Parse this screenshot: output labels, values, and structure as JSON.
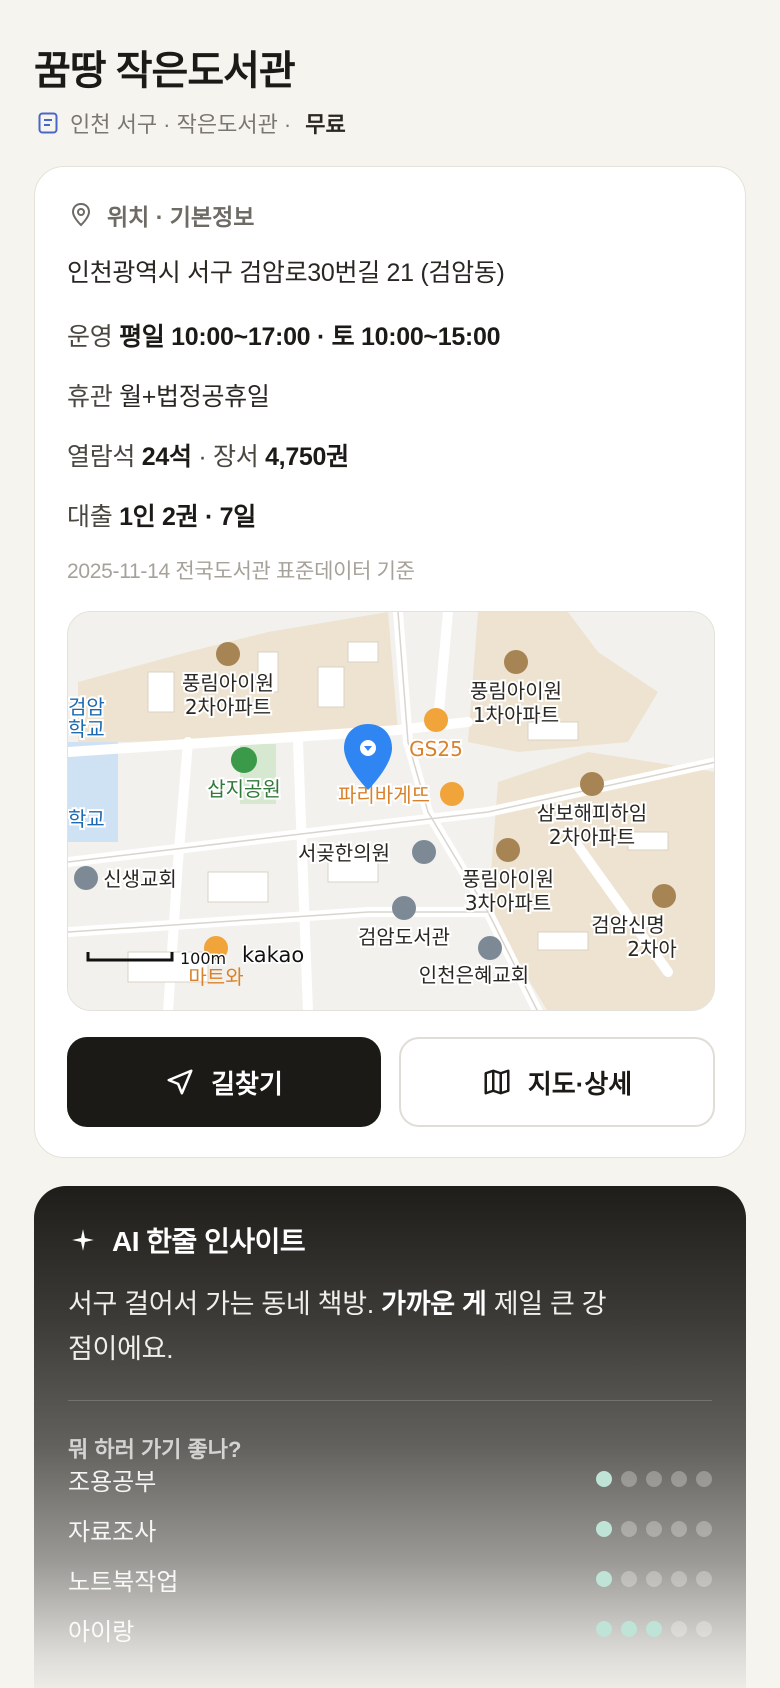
{
  "header": {
    "title": "꿈땅 작은도서관",
    "meta": "인천 서구 · 작은도서관 ·",
    "fee": "무료"
  },
  "info": {
    "section_title": "위치 · 기본정보",
    "address": "인천광역시 서구 검암로30번길 21 (검암동)",
    "hours_label": "운영",
    "hours_weekday": "평일 10:00~17:00",
    "hours_sep": "·",
    "hours_sat": "토 10:00~15:00",
    "closed_label": "휴관",
    "closed_value": "월+법정공휴일",
    "seats_label": "열람석",
    "seats_value": "24석",
    "books_label": "· 장서",
    "books_value": "4,750권",
    "loan_label": "대출",
    "loan_value": "1인 2권 · 7일",
    "data_date": "2025-11-14 전국도서관 표준데이터 기준"
  },
  "map": {
    "labels": {
      "apt2": [
        "풍림아이원",
        "2차아파트"
      ],
      "apt1": [
        "풍림아이원",
        "1차아파트"
      ],
      "school": [
        "검암",
        "학교"
      ],
      "school2": "학교",
      "park": "삽지공원",
      "gs25": "GS25",
      "bakery": "파리바게뜨",
      "samboh": [
        "삼보해피하임",
        "2차아파트"
      ],
      "clinic": "서곶한의원",
      "apt3": [
        "풍림아이원",
        "3차아파트"
      ],
      "church1": "신생교회",
      "library": "검암도서관",
      "singmyeong": [
        "검암신명",
        "2차아"
      ],
      "church2": "인천은혜교회",
      "mart": "마트와"
    },
    "scale": "100m",
    "brand": "kakao"
  },
  "actions": {
    "directions": "길찾기",
    "map_detail": "지도·상세"
  },
  "ai": {
    "title": "AI 한줄 인사이트",
    "text_pre": "서구 걸어서 가는 동네 책방.",
    "text_bold": "가까운 게",
    "text_post": "제일 큰 강점이에요.",
    "question": "뭐 하러 가기 좋나?",
    "activities": [
      {
        "name": "조용공부",
        "score": 1
      },
      {
        "name": "자료조사",
        "score": 1
      },
      {
        "name": "노트북작업",
        "score": 1
      },
      {
        "name": "아이랑",
        "score": 3
      }
    ],
    "max_score": 5,
    "accent": "#bfe3d6"
  }
}
